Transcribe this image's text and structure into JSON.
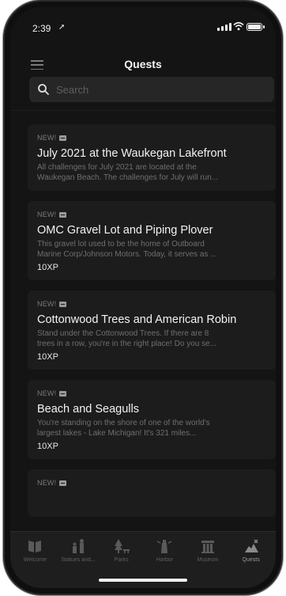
{
  "status_bar": {
    "time": "2:39"
  },
  "header": {
    "title": "Quests"
  },
  "search": {
    "placeholder": "Search",
    "value": ""
  },
  "quests": [
    {
      "badge": "NEW!",
      "title": "July 2021 at the Waukegan Lakefront",
      "desc_lines": [
        "All challenges for July 2021 are located at the",
        "Waukegan Beach. The challenges for July will run..."
      ],
      "xp": ""
    },
    {
      "badge": "NEW!",
      "title": "OMC Gravel Lot and Piping Plover",
      "desc_lines": [
        "This gravel lot used to be the home of Outboard",
        "Marine Corp/Johnson Motors. Today, it serves as ..."
      ],
      "xp": "10XP"
    },
    {
      "badge": "NEW!",
      "title": "Cottonwood Trees and American Robin",
      "desc_lines": [
        "Stand under the Cottonwood Trees. If there are 8",
        "trees in a row, you're in the right place! Do you se..."
      ],
      "xp": "10XP"
    },
    {
      "badge": "NEW!",
      "title": "Beach and Seagulls",
      "desc_lines": [
        "You're standing on the shore of one of the world's",
        "largest lakes - Lake Michigan! It's 321 miles..."
      ],
      "xp": "10XP"
    },
    {
      "badge": "NEW!"
    }
  ],
  "tabbar": {
    "tabs": [
      {
        "label": "Welcome",
        "icon": "book-icon"
      },
      {
        "label": "Statues and...",
        "icon": "statues-icon"
      },
      {
        "label": "Parks",
        "icon": "park-icon"
      },
      {
        "label": "Harbor",
        "icon": "harbor-icon"
      },
      {
        "label": "Museum",
        "icon": "museum-icon"
      },
      {
        "label": "Quests",
        "icon": "quests-icon"
      }
    ],
    "active": "Quests"
  }
}
